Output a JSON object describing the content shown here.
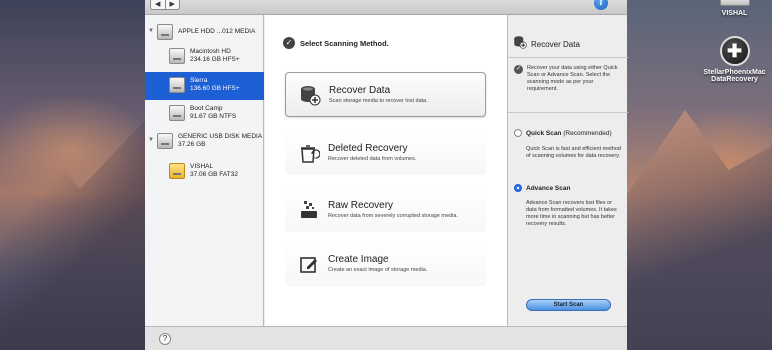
{
  "desktop": {
    "drive_label": "VISHAL",
    "app_label_line1": "StellarPhoenixMac",
    "app_label_line2": "DataRecovery"
  },
  "toolbar": {
    "back": "◀",
    "forward": "▶",
    "info": "i"
  },
  "sidebar": {
    "drives": [
      {
        "name": "APPLE HDD ...012 MEDIA",
        "size": "",
        "type": "disk"
      },
      {
        "name": "Macintosh HD",
        "size": "234.16 GB HFS+",
        "type": "volume"
      },
      {
        "name": "Sierra",
        "size": "136.60 GB HFS+",
        "type": "volume",
        "selected": true
      },
      {
        "name": "Boot Camp",
        "size": "91.67 GB NTFS",
        "type": "volume"
      },
      {
        "name": "GENERIC USB DISK MEDIA",
        "size": "37.26 GB",
        "type": "disk"
      },
      {
        "name": "VISHAL",
        "size": "37.06 GB FAT32",
        "type": "volume"
      }
    ]
  },
  "main": {
    "header": "Select Scanning Method.",
    "options": [
      {
        "title": "Recover Data",
        "desc": "Scan storage media to recover lost data."
      },
      {
        "title": "Deleted Recovery",
        "desc": "Recover deleted data from volumes."
      },
      {
        "title": "Raw Recovery",
        "desc": "Recover data from severely corrupted storage media."
      },
      {
        "title": "Create Image",
        "desc": "Create an exact image of storage media."
      }
    ]
  },
  "right": {
    "title": "Recover Data",
    "info": "Recover your data using either Quick Scan or Advance Scan. Select the scanning mode as per your requirement.",
    "quick_label": "Quick Scan",
    "quick_note": "(Recommended)",
    "quick_desc": "Quick Scan is fast and efficient method of scanning volumes for data recovery.",
    "advance_label": "Advance Scan",
    "advance_desc": "Advance Scan recovers lost files or data from formatted volumes. It takes more time in scanning but has better recovery results.",
    "start_button": "Start Scan"
  },
  "footer": {
    "help": "?"
  },
  "colors": {
    "selection": "#1d5fd4",
    "accent": "#4a90e2"
  }
}
